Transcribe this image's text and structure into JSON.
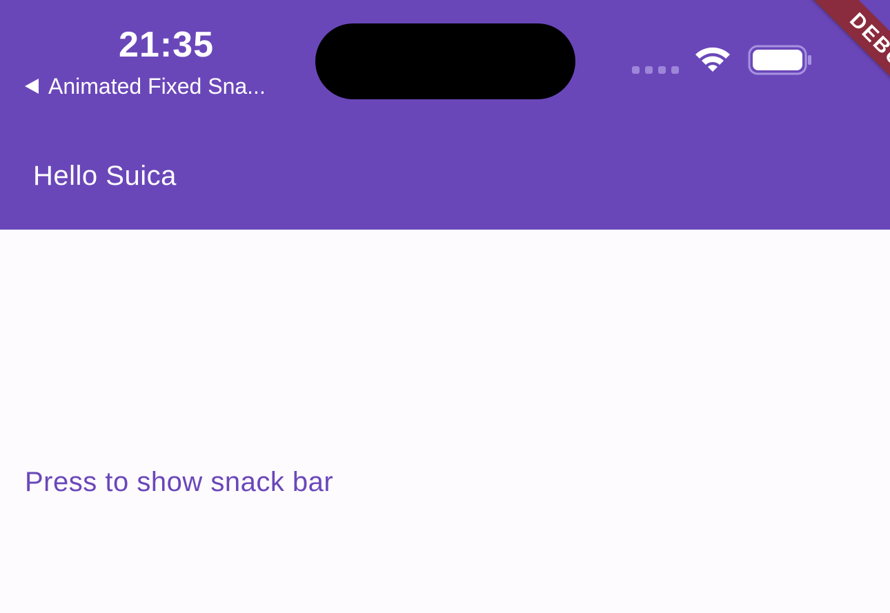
{
  "status_bar": {
    "time": "21:35",
    "back_app_label": "Animated Fixed Sna...",
    "back_icon": "back-triangle-icon",
    "wifi_icon": "wifi-icon",
    "battery_icon": "battery-icon",
    "cell_icon": "cell-signal-icon"
  },
  "debug_banner": {
    "label": "DEBUG",
    "color": "#8a2c3d"
  },
  "app_bar": {
    "title": "Hello Suica",
    "background": "#6a47b9"
  },
  "body": {
    "button_label": "Press to show snack bar",
    "button_color": "#6a47b9",
    "background": "#fdfbfe"
  }
}
